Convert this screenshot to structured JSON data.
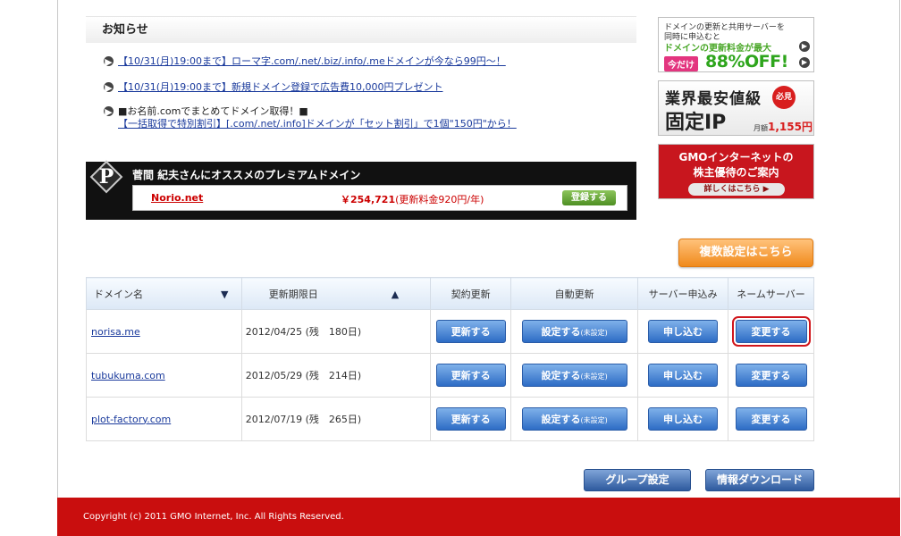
{
  "news": {
    "title": "お知らせ",
    "items": [
      {
        "link": "【10/31(月)19:00まで】ローマ字.com/.net/.biz/.info/.meドメインが今なら99円～！"
      },
      {
        "link": "【10/31(月)19:00まで】新規ドメイン登録で広告費10,000円プレゼント"
      },
      {
        "text": "■お名前.comでまとめてドメイン取得！■",
        "link": "【一括取得で特別割引】[.com/.net/.info]ドメインが「セット割引」で1個\"150円\"から！"
      }
    ]
  },
  "premium": {
    "logo_letter": "P",
    "title": "菅間 紀夫さんにオススメのプレミアムドメイン",
    "domain": "Norio.net",
    "price": "￥254,721",
    "fee": "(更新料金920円/年)",
    "register_label": "登録する"
  },
  "banners": {
    "b1": {
      "line1": "ドメインの更新と共用サーバーを",
      "line2": "同時に申込むと",
      "line3": "ドメインの更新料金が最大",
      "tag": "今だけ",
      "big": "88%OFF!"
    },
    "b2": {
      "line1": "業界最安値級",
      "line2": "固定IP",
      "badge": "必見",
      "unit": "月額",
      "price": "1,155円"
    },
    "b3": {
      "line1": "GMOインターネットの",
      "line2": "株主優待のご案内",
      "button": "詳しくはこちら"
    }
  },
  "bulk_label": "複数設定はこちら",
  "table": {
    "headers": {
      "domain": "ドメイン名",
      "expiry": "更新期限日",
      "renew": "契約更新",
      "auto": "自動更新",
      "server": "サーバー申込み",
      "nameserver": "ネームサーバー"
    },
    "sort_domain": "▼",
    "sort_expiry": "▲",
    "buttons": {
      "renew": "更新する",
      "auto": "設定する",
      "auto_status": "(未設定)",
      "server": "申し込む",
      "nameserver": "変更する"
    },
    "rows": [
      {
        "domain": "norisa.me",
        "expiry": "2012/04/25 (残　180日)"
      },
      {
        "domain": "tubukuma.com",
        "expiry": "2012/05/29 (残　214日)"
      },
      {
        "domain": "plot-factory.com",
        "expiry": "2012/07/19 (残　265日)"
      }
    ]
  },
  "bottom_buttons": {
    "group": "グループ設定",
    "download": "情報ダウンロード"
  },
  "footer": "Copyright (c) 2011 GMO Internet, Inc. All Rights Reserved."
}
